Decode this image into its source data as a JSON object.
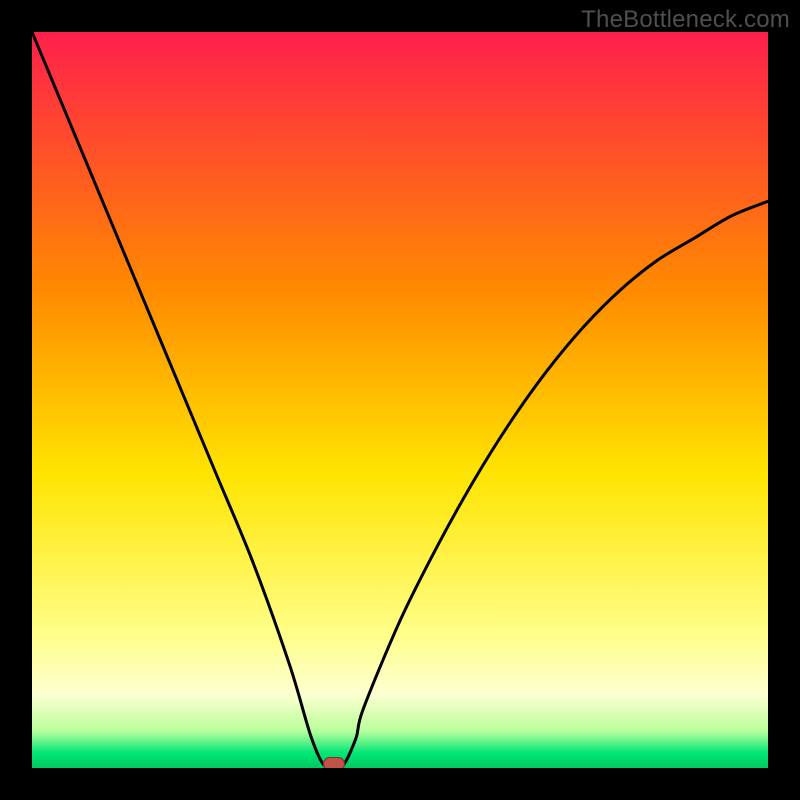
{
  "watermark": "TheBottleneck.com",
  "colors": {
    "frame": "#000000",
    "top": "#ff1f4b",
    "mid_upper": "#ff9a00",
    "mid": "#ffe400",
    "mid_lower": "#ffff8a",
    "green_band_top": "#d6ff8e",
    "green": "#00e676",
    "curve": "#000000",
    "marker_fill": "#c1524a",
    "marker_stroke": "#7d2f29"
  },
  "chart_data": {
    "type": "line",
    "title": "",
    "xlabel": "",
    "ylabel": "",
    "xlim": [
      0,
      100
    ],
    "ylim": [
      0,
      100
    ],
    "series": [
      {
        "name": "bottleneck-curve",
        "x": [
          0,
          5,
          10,
          15,
          20,
          25,
          30,
          35,
          38,
          40,
          42,
          44,
          45,
          50,
          55,
          60,
          65,
          70,
          75,
          80,
          85,
          90,
          95,
          100
        ],
        "y": [
          100,
          88,
          76,
          64,
          52,
          40,
          28,
          14,
          4,
          0,
          0,
          4,
          8,
          20,
          30,
          39,
          47,
          54,
          60,
          65,
          69,
          72,
          75,
          77
        ]
      }
    ],
    "optimum_marker": {
      "x": 41,
      "y": 0
    },
    "gradient_stops": [
      {
        "pct": 0,
        "color": "#ff1f4b"
      },
      {
        "pct": 35,
        "color": "#ff8a00"
      },
      {
        "pct": 60,
        "color": "#ffe400"
      },
      {
        "pct": 82,
        "color": "#ffff8a"
      },
      {
        "pct": 90,
        "color": "#fdffd0"
      },
      {
        "pct": 95,
        "color": "#b8ff9a"
      },
      {
        "pct": 98,
        "color": "#00e676"
      },
      {
        "pct": 100,
        "color": "#00c95f"
      }
    ]
  }
}
